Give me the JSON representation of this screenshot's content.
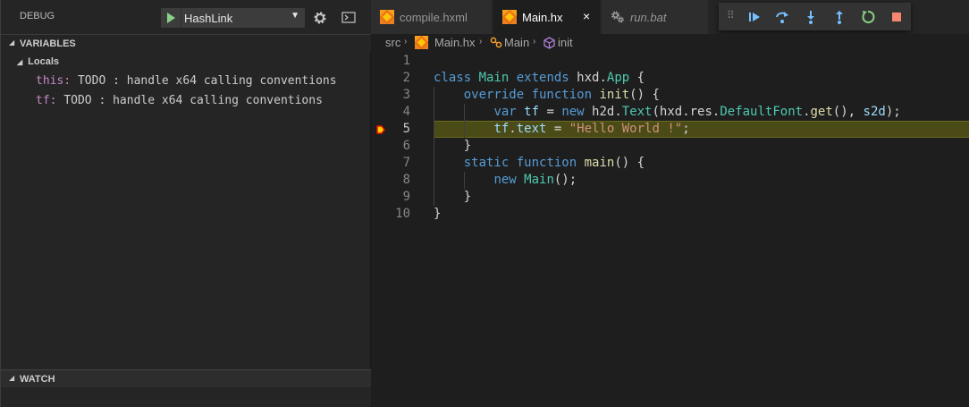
{
  "sidebar": {
    "title": "DEBUG",
    "config": "HashLink",
    "variables_label": "VARIABLES",
    "locals_label": "Locals",
    "variables": [
      {
        "name": "this:",
        "value": "TODO : handle x64 calling conventions"
      },
      {
        "name": "tf:",
        "value": "TODO : handle x64 calling conventions"
      }
    ],
    "watch_label": "WATCH"
  },
  "tabs": [
    {
      "label": "compile.hxml",
      "icon": "haxe-icon"
    },
    {
      "label": "Main.hx",
      "icon": "haxe-icon",
      "active": true,
      "close": "×"
    },
    {
      "label": "run.bat",
      "icon": "gears-icon"
    }
  ],
  "breadcrumb": {
    "folder": "src",
    "file": "Main.hx",
    "class": "Main",
    "method": "init"
  },
  "editor": {
    "current_line": 5,
    "line_numbers": [
      "1",
      "2",
      "3",
      "4",
      "5",
      "6",
      "7",
      "8",
      "9",
      "10"
    ]
  },
  "debug_toolbar": [
    "continue-icon",
    "step-over-icon",
    "step-into-icon",
    "step-out-icon",
    "restart-icon",
    "stop-icon"
  ],
  "colors": {
    "accent": "#75beff",
    "highlight": "#4b4b18",
    "haxe": "#f47216",
    "stop": "#f48771",
    "restart": "#89d185"
  }
}
